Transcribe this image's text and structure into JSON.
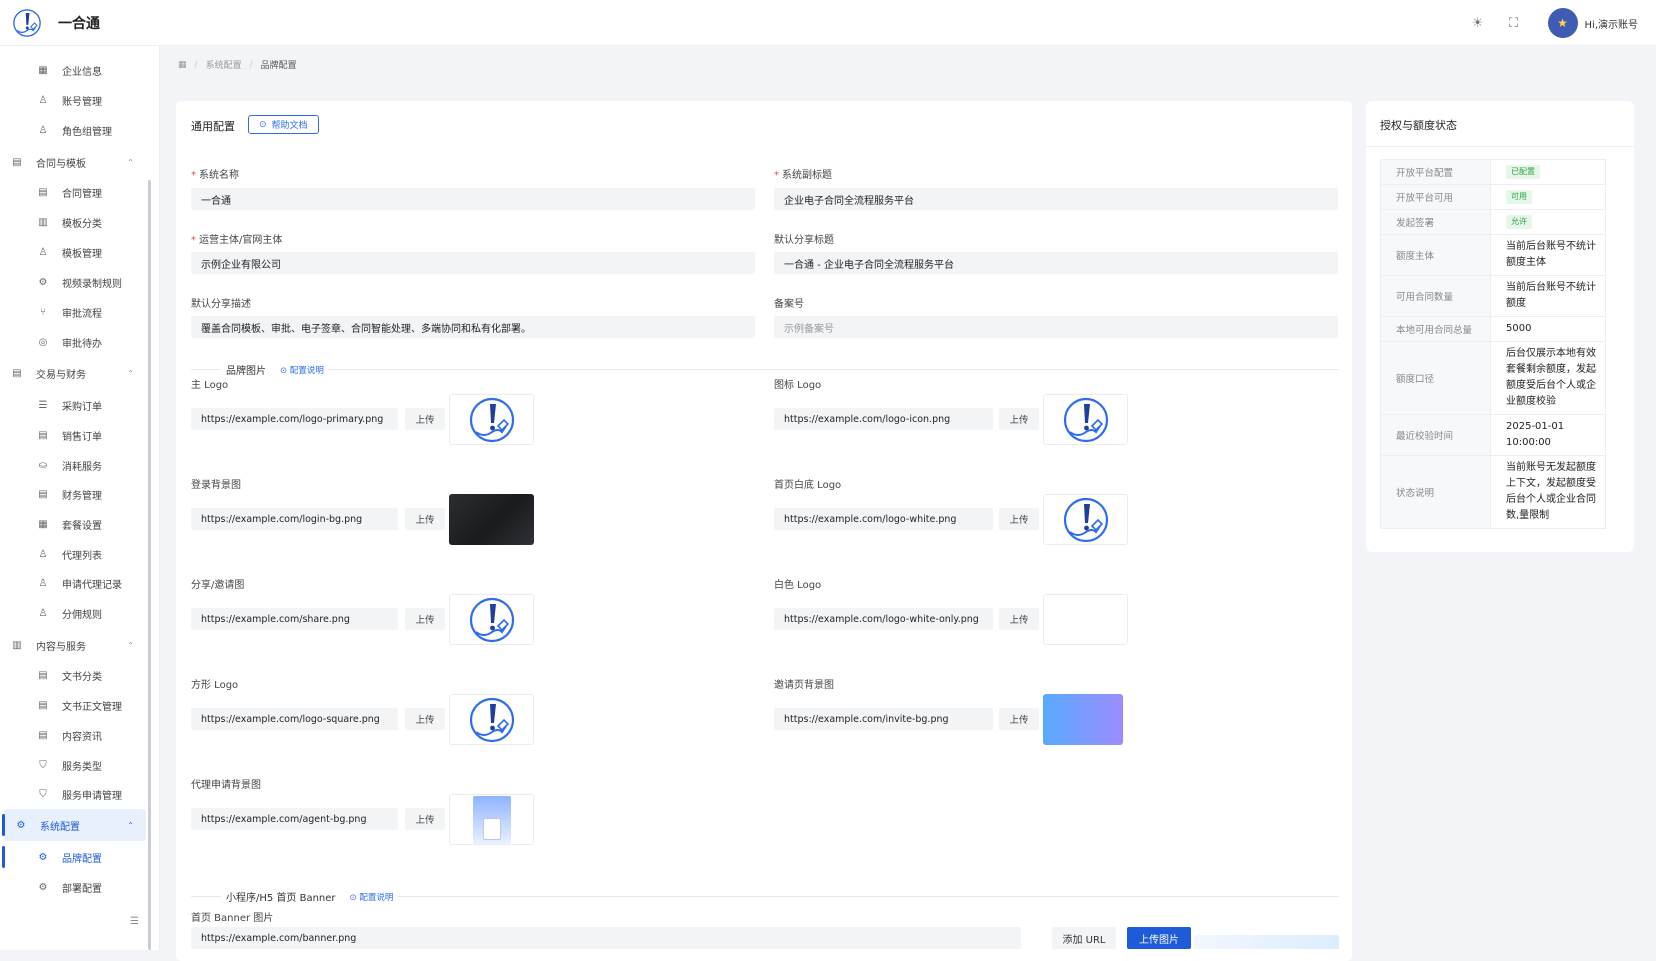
{
  "header": {
    "app_name": "一合通",
    "greeting": "Hi,演示账号",
    "icons": [
      "brightness-icon",
      "fullscreen-icon"
    ]
  },
  "sidebar": {
    "items": [
      {
        "label": "企业信息",
        "icon": "▦",
        "type": "child"
      },
      {
        "label": "账号管理",
        "icon": "♙",
        "type": "child"
      },
      {
        "label": "角色组管理",
        "icon": "♙",
        "type": "child"
      },
      {
        "label": "合同与模板",
        "icon": "▤",
        "type": "group"
      },
      {
        "label": "合同管理",
        "icon": "▤",
        "type": "child"
      },
      {
        "label": "模板分类",
        "icon": "▥",
        "type": "child"
      },
      {
        "label": "模板管理",
        "icon": "♙",
        "type": "child"
      },
      {
        "label": "视频录制规则",
        "icon": "⚙",
        "type": "child"
      },
      {
        "label": "审批流程",
        "icon": "⑂",
        "type": "child"
      },
      {
        "label": "审批待办",
        "icon": "◎",
        "type": "child"
      },
      {
        "label": "交易与财务",
        "icon": "▤",
        "type": "group"
      },
      {
        "label": "采购订单",
        "icon": "☰",
        "type": "child"
      },
      {
        "label": "销售订单",
        "icon": "▤",
        "type": "child"
      },
      {
        "label": "消耗服务",
        "icon": "⛀",
        "type": "child"
      },
      {
        "label": "财务管理",
        "icon": "▤",
        "type": "child"
      },
      {
        "label": "套餐设置",
        "icon": "▦",
        "type": "child"
      },
      {
        "label": "代理列表",
        "icon": "♙",
        "type": "child"
      },
      {
        "label": "申请代理记录",
        "icon": "♙",
        "type": "child"
      },
      {
        "label": "分佣规则",
        "icon": "♙",
        "type": "child"
      },
      {
        "label": "内容与服务",
        "icon": "▥",
        "type": "group"
      },
      {
        "label": "文书分类",
        "icon": "▤",
        "type": "child"
      },
      {
        "label": "文书正文管理",
        "icon": "▤",
        "type": "child"
      },
      {
        "label": "内容资讯",
        "icon": "▤",
        "type": "child"
      },
      {
        "label": "服务类型",
        "icon": "⛉",
        "type": "child"
      },
      {
        "label": "服务申请管理",
        "icon": "⛉",
        "type": "child"
      },
      {
        "label": "系统配置",
        "icon": "⚙",
        "type": "group",
        "active": true
      },
      {
        "label": "品牌配置",
        "icon": "⚙",
        "type": "child",
        "active": true
      },
      {
        "label": "部署配置",
        "icon": "⚙",
        "type": "child"
      }
    ]
  },
  "breadcrumb": {
    "home_icon": "▦",
    "items": [
      "系统配置",
      "品牌配置"
    ]
  },
  "general": {
    "title": "通用配置",
    "help_button": "帮助文档",
    "fields": {
      "system_name": {
        "label": "系统名称",
        "value": "一合通"
      },
      "system_subtitle": {
        "label": "系统副标题",
        "value": "企业电子合同全流程服务平台"
      },
      "operator": {
        "label": "运营主体/官网主体",
        "value": "示例企业有限公司"
      },
      "share_title": {
        "label": "默认分享标题",
        "value": "一合通 - 企业电子合同全流程服务平台"
      },
      "share_desc": {
        "label": "默认分享描述",
        "value": "覆盖合同模板、审批、电子签章、合同智能处理、多端协同和私有化部署。"
      },
      "icp": {
        "label": "备案号",
        "placeholder": "示例备案号"
      }
    },
    "brand_section": {
      "title": "品牌图片",
      "link": "配置说明"
    },
    "images": {
      "main_logo": {
        "label": "主 Logo",
        "url": "https://example.com/logo-primary.png"
      },
      "icon_logo": {
        "label": "图标 Logo",
        "url": "https://example.com/logo-icon.png"
      },
      "login_bg": {
        "label": "登录背景图",
        "url": "https://example.com/login-bg.png"
      },
      "home_white_logo": {
        "label": "首页白底 Logo",
        "url": "https://example.com/logo-white.png"
      },
      "share_img": {
        "label": "分享/邀请图",
        "url": "https://example.com/share.png"
      },
      "white_logo": {
        "label": "白色 Logo",
        "url": "https://example.com/logo-white-only.png"
      },
      "square_logo": {
        "label": "方形 Logo",
        "url": "https://example.com/logo-square.png"
      },
      "invite_bg": {
        "label": "邀请页背景图",
        "url": "https://example.com/invite-bg.png"
      },
      "agent_bg": {
        "label": "代理申请背景图",
        "url": "https://example.com/agent-bg.png"
      }
    },
    "upload_label": "上传",
    "banner_section": {
      "title": "小程序/H5 首页 Banner",
      "link": "配置说明"
    },
    "banner": {
      "label": "首页 Banner 图片",
      "url": "https://example.com/banner.png",
      "add_url": "添加 URL",
      "upload": "上传图片"
    }
  },
  "auth_status": {
    "title": "授权与额度状态",
    "rows": [
      {
        "key": "开放平台配置",
        "value": "已配置",
        "tag": true
      },
      {
        "key": "开放平台可用",
        "value": "可用",
        "tag": true
      },
      {
        "key": "发起签署",
        "value": "允许",
        "tag": true
      },
      {
        "key": "额度主体",
        "value": "当前后台账号不统计额度主体"
      },
      {
        "key": "可用合同数量",
        "value": "当前后台账号不统计额度"
      },
      {
        "key": "本地可用合同总量",
        "value": "5000"
      },
      {
        "key": "额度口径",
        "value": "后台仅展示本地有效套餐剩余额度，发起额度受后台个人或企业额度校验"
      },
      {
        "key": "最近校验时间",
        "value": "2025-01-01 10:00:00"
      },
      {
        "key": "状态说明",
        "value": "当前账号无发起额度上下文，发起额度受后台个人或企业合同数,量限制"
      }
    ]
  }
}
